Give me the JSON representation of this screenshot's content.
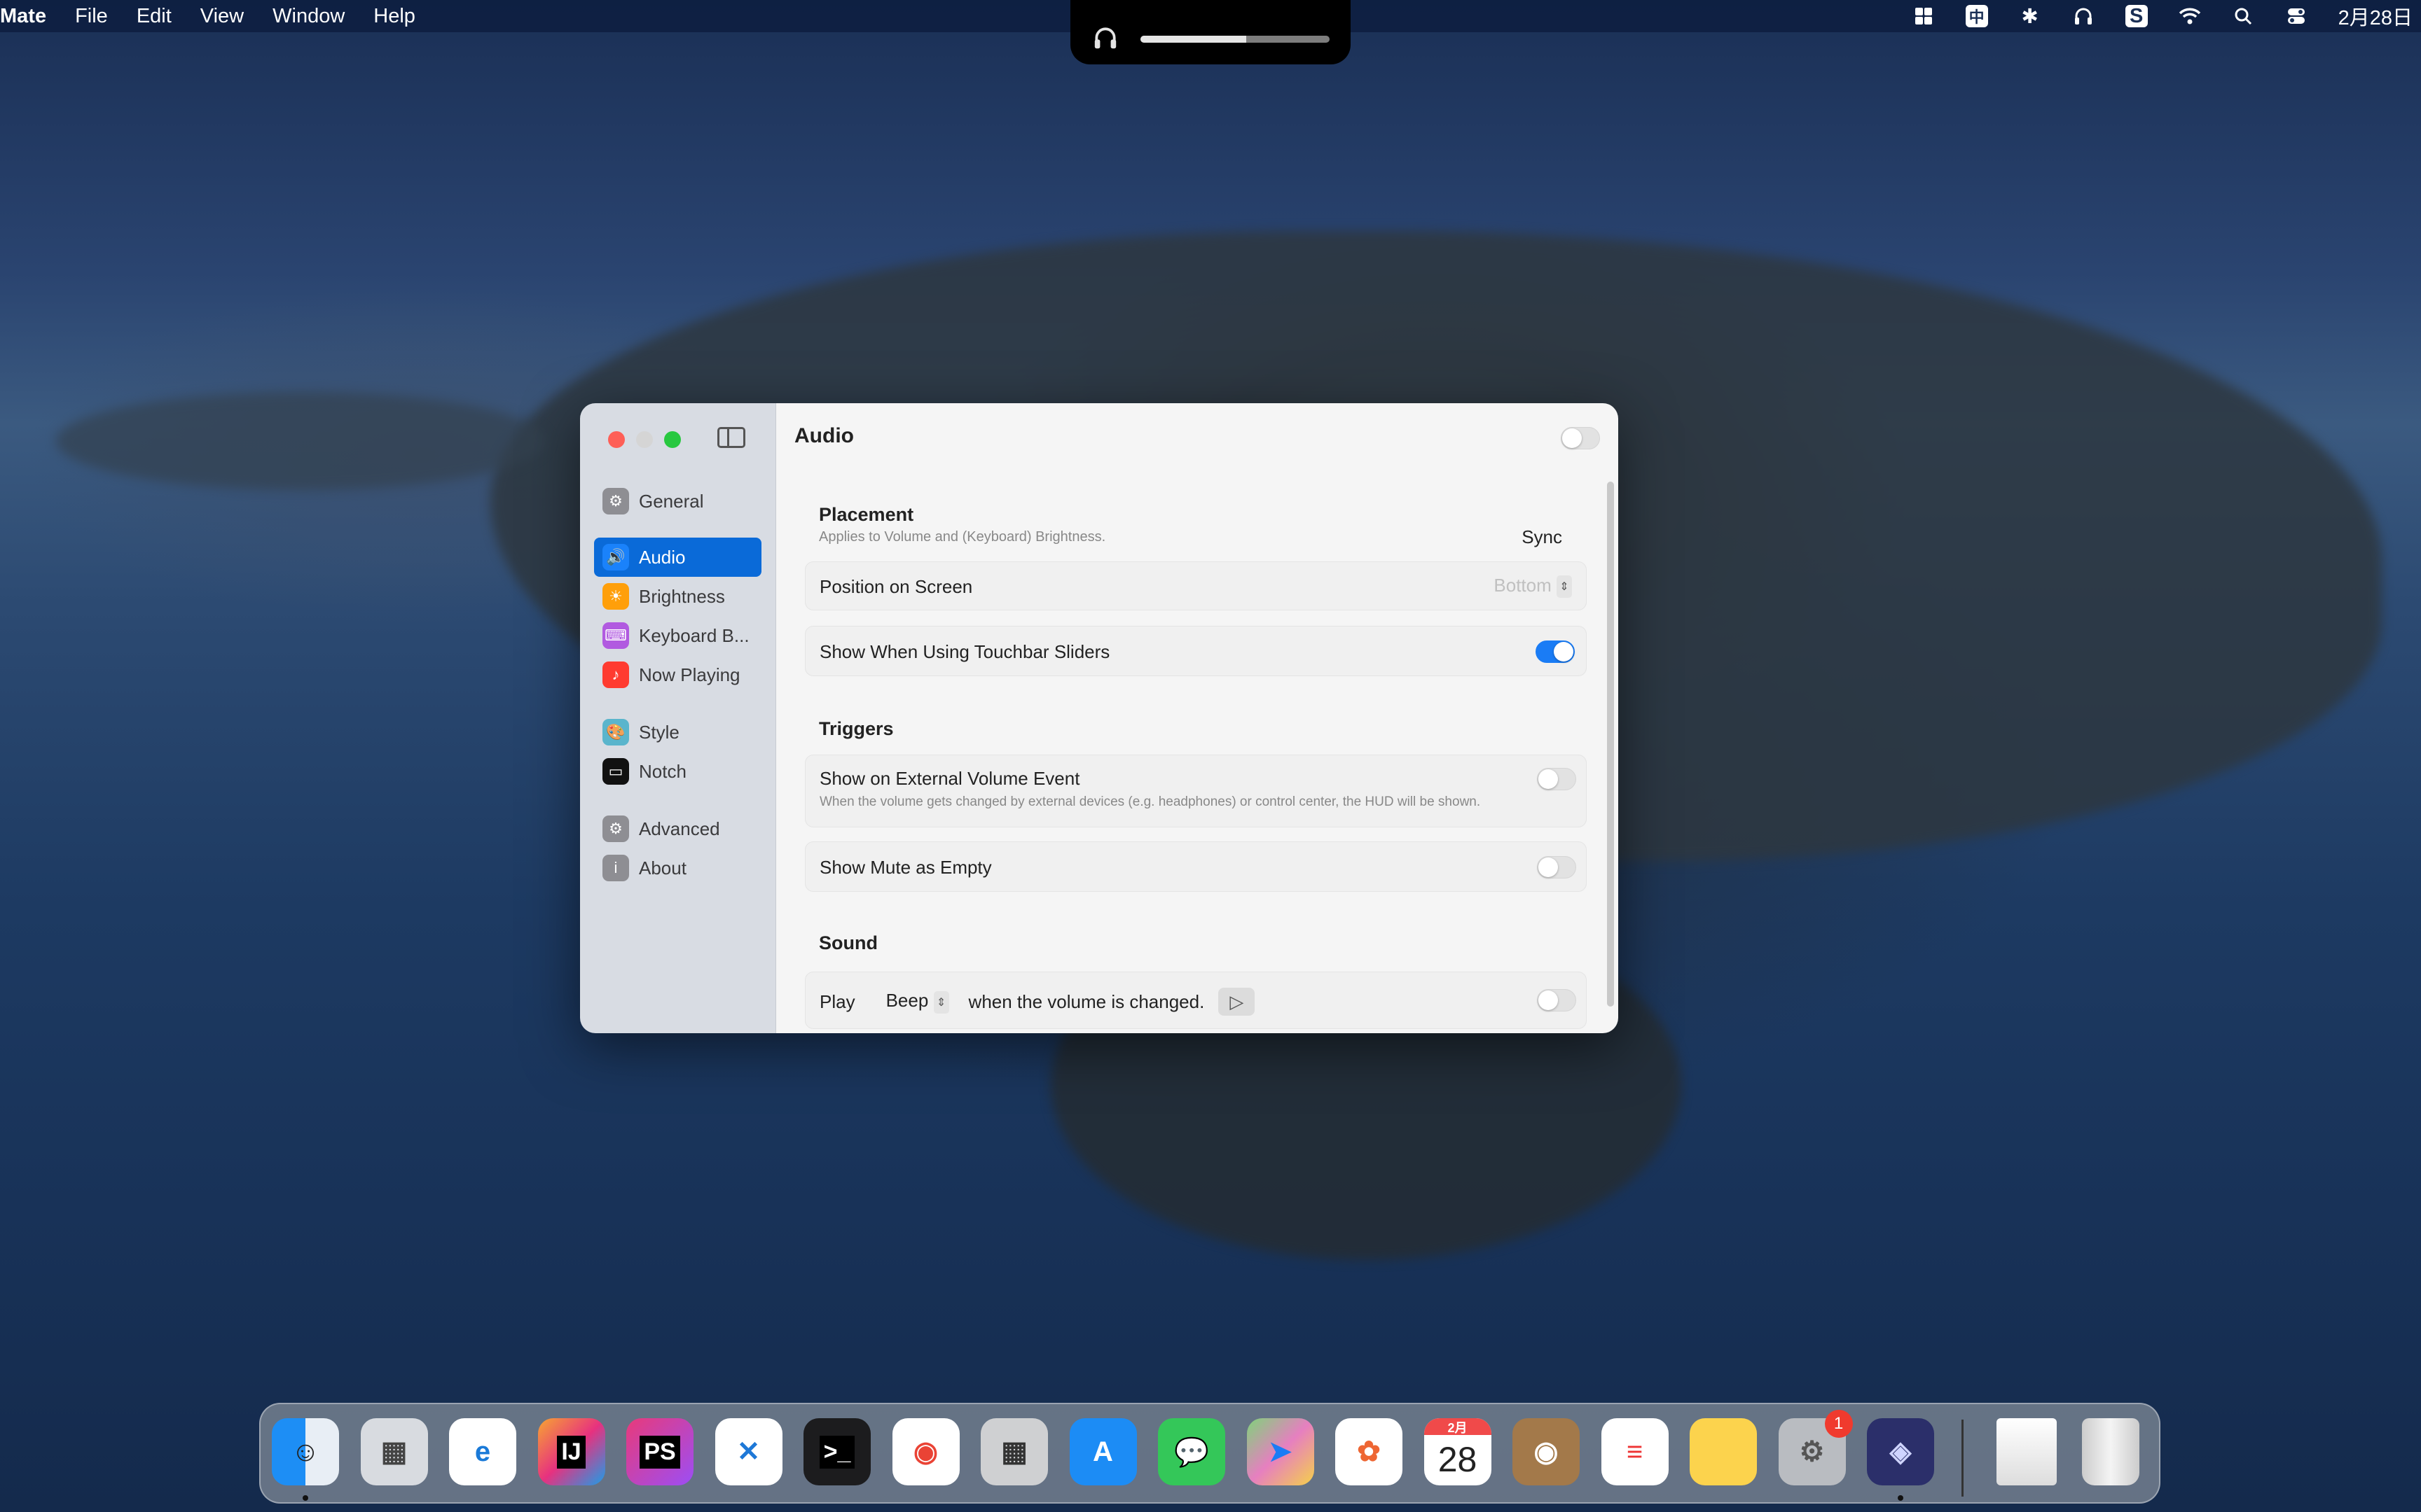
{
  "menubar": {
    "app_name": "Mate",
    "menus": [
      "File",
      "Edit",
      "View",
      "Window",
      "Help"
    ],
    "status_icons": [
      "grid-icon",
      "input-method-icon",
      "bluetooth-icon",
      "headphones-icon",
      "s-app-icon",
      "wifi-icon",
      "search-icon",
      "control-center-icon"
    ],
    "input_method_glyph": "中",
    "date": "2月28日"
  },
  "hud": {
    "icon": "headphones-icon",
    "volume_percent": 56
  },
  "window": {
    "sidebar": {
      "items": [
        {
          "label": "General",
          "icon": "gear-icon",
          "color": "#8e8e93",
          "glyph": "⚙"
        },
        {
          "label": "Audio",
          "icon": "speaker-icon",
          "color": "#1a82fb",
          "glyph": "🔊",
          "selected": true
        },
        {
          "label": "Brightness",
          "icon": "sun-icon",
          "color": "#ff9f0a",
          "glyph": "☀"
        },
        {
          "label": "Keyboard B...",
          "icon": "keyboard-icon",
          "color": "#b15ae0",
          "glyph": "⌨"
        },
        {
          "label": "Now Playing",
          "icon": "music-note-icon",
          "color": "#ff3b30",
          "glyph": "♪"
        },
        {
          "label": "Style",
          "icon": "palette-icon",
          "color": "#5ab5cc",
          "glyph": "🎨"
        },
        {
          "label": "Notch",
          "icon": "display-icon",
          "color": "#111111",
          "glyph": "▭"
        },
        {
          "label": "Advanced",
          "icon": "gears-icon",
          "color": "#8e8e93",
          "glyph": "⚙"
        },
        {
          "label": "About",
          "icon": "info-icon",
          "color": "#8e8e93",
          "glyph": "i"
        }
      ]
    },
    "title": "Audio",
    "header_toggle_on": false,
    "placement": {
      "heading": "Placement",
      "subtitle": "Applies to Volume and (Keyboard) Brightness.",
      "sync_label": "Sync",
      "sync_on": true,
      "position_label": "Position on Screen",
      "position_value": "Bottom",
      "touchbar_label": "Show When Using Touchbar Sliders",
      "touchbar_on": true
    },
    "triggers": {
      "heading": "Triggers",
      "external_label": "Show on External Volume Event",
      "external_desc": "When the volume gets changed by external devices (e.g. headphones) or control center, the HUD will be shown.",
      "external_on": false,
      "mute_label": "Show Mute as Empty",
      "mute_on": false
    },
    "sound": {
      "heading": "Sound",
      "play_label": "Play",
      "sound_value": "Beep",
      "suffix": "when the volume is changed.",
      "preview_glyph": "▷",
      "enabled": false
    }
  },
  "dock": {
    "apps": [
      {
        "name": "Finder",
        "running": true
      },
      {
        "name": "Launchpad"
      },
      {
        "name": "Microsoft Edge"
      },
      {
        "name": "IntelliJ IDEA",
        "label": "IJ"
      },
      {
        "name": "PhpStorm",
        "label": "PS"
      },
      {
        "name": "Visual Studio Code"
      },
      {
        "name": "Terminal",
        "label": ">_"
      },
      {
        "name": "Google Chrome"
      },
      {
        "name": "Calculator"
      },
      {
        "name": "App Store"
      },
      {
        "name": "Messages"
      },
      {
        "name": "Maps"
      },
      {
        "name": "Photos"
      },
      {
        "name": "Calendar",
        "month": "2月",
        "day": "28"
      },
      {
        "name": "Contacts"
      },
      {
        "name": "Reminders"
      },
      {
        "name": "Notes"
      },
      {
        "name": "System Preferences",
        "badge": "1"
      },
      {
        "name": "Mate",
        "running": true
      }
    ],
    "others": [
      {
        "name": "Downloads stack"
      },
      {
        "name": "Trash"
      }
    ]
  }
}
